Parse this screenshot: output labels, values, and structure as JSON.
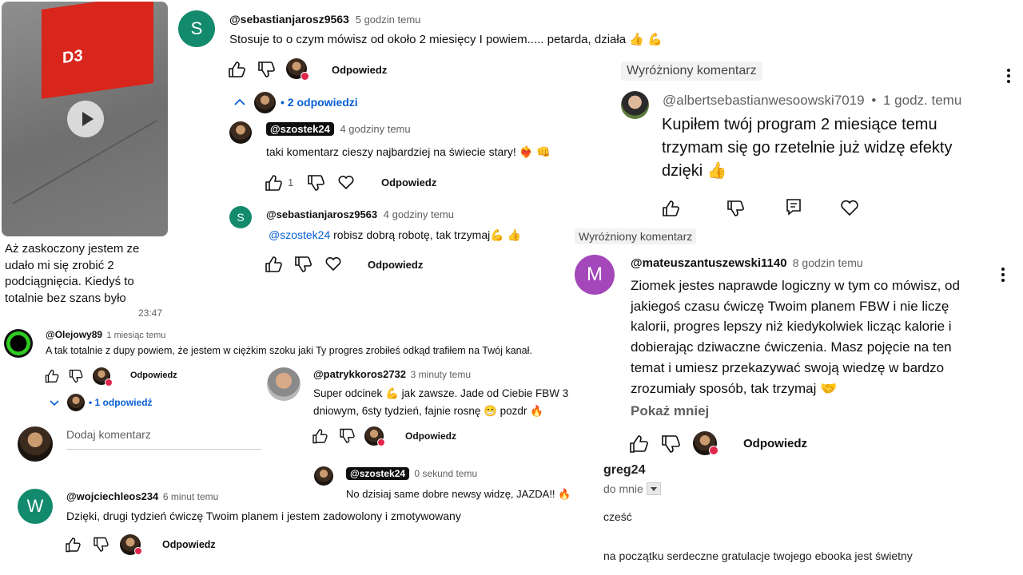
{
  "video_card": {
    "caption": "Aż zaskoczony jestem ze udało mi się zrobić 2 podciągnięcia. Kiedyś to totalnie bez szans było",
    "time": "23:47",
    "box_label": "D3"
  },
  "top_thread": {
    "comment": {
      "avatar_letter": "S",
      "username": "@sebastianjarosz9563",
      "time": "5 godzin temu",
      "text": "Stosuje to o czym mówisz od około 2 miesięcy I powiem..... petarda, działa 👍 💪",
      "reply_label": "Odpowiedz"
    },
    "replies_toggle": "2 odpowiedzi",
    "replies": [
      {
        "username": "@szostek24",
        "time": "4 godziny temu",
        "text": "taki komentarz cieszy najbardziej na świecie stary! ❤️‍🔥 👊",
        "likes": "1",
        "reply_label": "Odpowiedz"
      },
      {
        "avatar_letter": "S",
        "username": "@sebastianjarosz9563",
        "time": "4 godziny temu",
        "mention": "@szostek24",
        "text": " robisz dobrą robotę, tak trzymaj💪 👍",
        "reply_label": "Odpowiedz"
      }
    ]
  },
  "pinned_a": {
    "badge": "Wyróżniony komentarz",
    "username": "@albertsebastianwesoowski7019",
    "separator": "•",
    "time": "1 godz. temu",
    "text": "Kupiłem twój program 2 miesiące temu trzymam się go rzetelnie już widzę efekty dzięki 👍"
  },
  "pinned_b": {
    "badge": "Wyróżniony komentarz",
    "avatar_letter": "M",
    "username": "@mateuszantuszewski1140",
    "time": "8 godzin temu",
    "text": "Ziomek jestes naprawde logiczny w tym co mówisz, od jakiegoś czasu ćwiczę Twoim planem FBW i nie liczę kalorii, progres lepszy niż kiedykolwiek licząc kalorie i dobierając dziwaczne ćwiczenia. Masz pojęcie na ten temat i umiesz przekazywać swoją wiedzę w bardzo zrozumiały sposób, tak trzymaj 🤝",
    "show_less": "Pokaż mniej",
    "reply_label": "Odpowiedz"
  },
  "olejowy": {
    "username": "@Olejowy89",
    "time": "1 miesiąc temu",
    "text": "A tak totalnie z dupy powiem, że jestem w ciężkim szoku jaki Ty progres zrobiłeś odkąd trafiłem na Twój kanał.",
    "reply_label": "Odpowiedz",
    "replies_toggle": "1 odpowiedź",
    "add_comment_placeholder": "Dodaj komentarz"
  },
  "patryk": {
    "username": "@patrykkoros2732",
    "time": "3 minuty temu",
    "text": "Super odcinek 💪 jak zawsze. Jade od Ciebie FBW 3 dniowym, 6sty tydzień, fajnie rosnę 😁 pozdr 🔥",
    "reply_label": "Odpowiedz",
    "reply": {
      "username": "@szostek24",
      "time": "0 sekund temu",
      "text": "No dzisiaj same dobre newsy widzę, JAZDA!! 🔥"
    }
  },
  "wojciech": {
    "avatar_letter": "W",
    "username": "@wojciechleos234",
    "time": "6 minut temu",
    "text": "Dzięki, drugi tydzień ćwiczę Twoim planem i jestem zadowolony i zmotywowany",
    "reply_label": "Odpowiedz"
  },
  "email": {
    "sender": "greg24",
    "to": "do mnie",
    "line1": "cześć",
    "line2": "na początku serdeczne gratulacje twojego ebooka jest świetny"
  },
  "colors": {
    "s_avatar": "#138a6d",
    "m_avatar": "#a347ba",
    "w_avatar": "#138a6d",
    "link": "#065fd4"
  }
}
